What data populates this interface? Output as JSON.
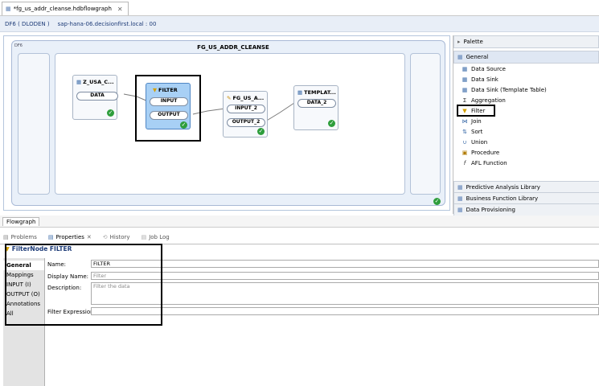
{
  "editor_tab": {
    "title": "*fg_us_addr_cleanse.hdbflowgraph"
  },
  "connection": {
    "name": "DF6 ( DLODEN )",
    "host": "sap-hana-06.decisionfirst.local : 00"
  },
  "flowgraph": {
    "title": "FG_US_ADDR_CLEANSE",
    "corner_label": "DF6"
  },
  "nodes": {
    "source": {
      "title": "Z_USA_C...",
      "port": "DATA"
    },
    "filter": {
      "title": "FILTER",
      "input": "INPUT",
      "output": "OUTPUT"
    },
    "cleanse": {
      "title": "FG_US_A...",
      "input": "INPUT_2",
      "output": "OUTPUT_2"
    },
    "template": {
      "title": "TEMPLAT...",
      "port": "DATA_2"
    }
  },
  "palette": {
    "title": "Palette",
    "general": "General",
    "items": [
      "Data Source",
      "Data Sink",
      "Data Sink (Template Table)",
      "Aggregation",
      "Filter",
      "Join",
      "Sort",
      "Union",
      "Procedure",
      "AFL Function"
    ],
    "sections": [
      "Predictive Analysis Library",
      "Business Function Library",
      "Data Provisioning"
    ]
  },
  "bottom_tab": "Flowgraph",
  "views": [
    "Problems",
    "Properties",
    "History",
    "Job Log"
  ],
  "properties": {
    "title": "FilterNode FILTER",
    "nav": [
      "General",
      "Mappings",
      "INPUT (I)",
      "OUTPUT (O)",
      "Annotations",
      "All"
    ],
    "labels": {
      "name": "Name:",
      "display": "Display Name:",
      "description": "Description:",
      "filter": "Filter Expression:"
    },
    "values": {
      "name": "FILTER",
      "display": "Filter",
      "description": "Filter the data",
      "filter": ""
    }
  }
}
